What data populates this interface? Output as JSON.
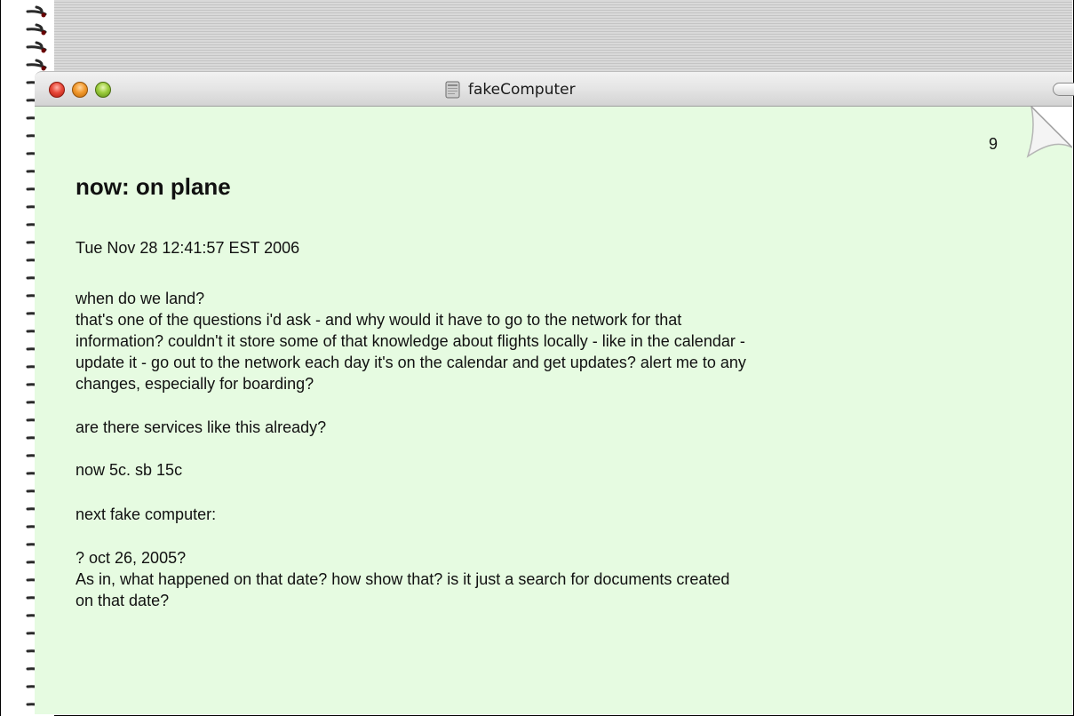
{
  "window": {
    "title": "fakeComputer",
    "buttons": {
      "close": "close-button",
      "minimize": "minimize-button",
      "zoom": "zoom-button"
    },
    "icons": [
      "document-icon",
      "toolbar-toggle-icon",
      "page-curl-icon",
      "spiral-binding-icon"
    ]
  },
  "page": {
    "number": "9",
    "heading": "now: on plane",
    "timestamp": "Tue Nov 28 12:41:57 EST 2006",
    "lines": [
      "when do we land?",
      "that's one of the questions i'd ask - and why would it have to go to the network for that",
      "information? couldn't it store some of that knowledge about flights locally - like in the calendar -",
      "update it - go out to the network each day it's on the calendar and get updates? alert me to any",
      "changes, especially for boarding?",
      "are there services like this already?",
      "now 5c. sb 15c",
      "next fake computer:",
      "? oct 26, 2005?",
      "As in, what happened on that date? how show that? is it just a search for documents created",
      "on that date?"
    ]
  },
  "colors": {
    "page_background": "#e6fbe1",
    "text": "#111111"
  }
}
